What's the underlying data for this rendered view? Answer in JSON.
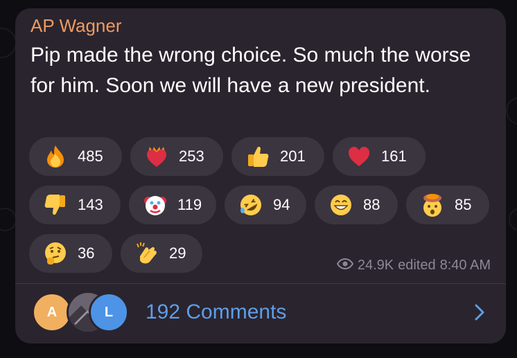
{
  "message": {
    "author": "AP Wagner",
    "text": "Pip made the wrong choice. So much the worse for him. Soon we will have a new president."
  },
  "reactions": [
    {
      "icon": "fire-emoji",
      "count": "485"
    },
    {
      "icon": "heart-on-fire-emoji",
      "count": "253"
    },
    {
      "icon": "thumbs-up-emoji",
      "count": "201"
    },
    {
      "icon": "red-heart-emoji",
      "count": "161"
    },
    {
      "icon": "thumbs-down-emoji",
      "count": "143"
    },
    {
      "icon": "clown-face-emoji",
      "count": "119"
    },
    {
      "icon": "rolling-laughing-emoji",
      "count": "94"
    },
    {
      "icon": "grinning-face-emoji",
      "count": "88"
    },
    {
      "icon": "exploding-head-emoji",
      "count": "85"
    },
    {
      "icon": "thinking-face-emoji",
      "count": "36"
    },
    {
      "icon": "clapping-hands-emoji",
      "count": "29"
    }
  ],
  "meta": {
    "views": "24.9K",
    "edited_label": "edited",
    "time": "8:40 AM"
  },
  "comments": {
    "label": "192 Comments",
    "avatars": [
      "A",
      "L"
    ]
  },
  "colors": {
    "author": "#ec9b62",
    "link": "#5e9ee8",
    "bubble": "#2a242e",
    "pill": "#3b3540"
  }
}
